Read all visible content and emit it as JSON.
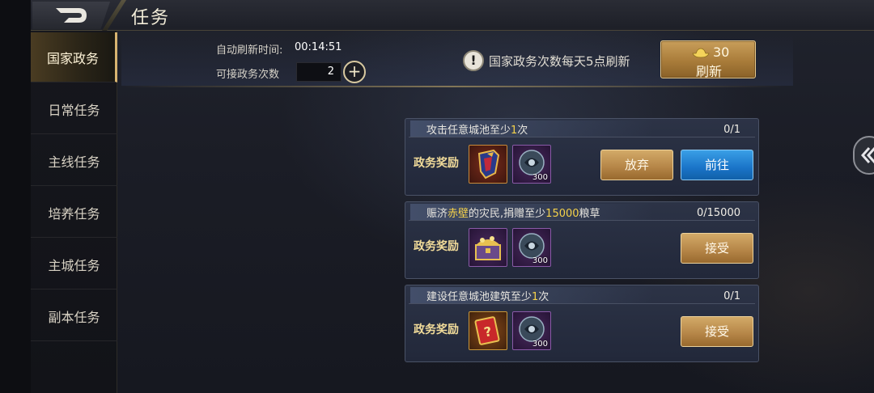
{
  "header": {
    "title": "任务"
  },
  "sidebar": {
    "items": [
      {
        "label": "国家政务",
        "active": true
      },
      {
        "label": "日常任务",
        "active": false
      },
      {
        "label": "主线任务",
        "active": false
      },
      {
        "label": "培养任务",
        "active": false
      },
      {
        "label": "主城任务",
        "active": false
      },
      {
        "label": "副本任务",
        "active": false
      }
    ]
  },
  "info": {
    "refresh_time_label": "自动刷新时间:",
    "refresh_time_value": "00:14:51",
    "count_label": "可接政务次数",
    "count_value": "2",
    "plus_glyph": "+",
    "notice_glyph": "!",
    "notice_text": "国家政务次数每天5点刷新",
    "refresh_cost": "30",
    "refresh_label": "刷新"
  },
  "reward_label": "政务奖励",
  "tasks": [
    {
      "title_parts": [
        "攻击任意城池至少",
        "1",
        "次"
      ],
      "progress": "0/1",
      "rewards": [
        {
          "icon": "armor-item-icon",
          "qty": ""
        },
        {
          "icon": "orb-resource-icon",
          "qty": "300"
        }
      ],
      "buttons": [
        "放弃",
        "前往"
      ]
    },
    {
      "title_parts": [
        "赈济",
        "赤壁",
        "的灾民,捐赠至少",
        "15000",
        "粮草"
      ],
      "progress": "0/15000",
      "rewards": [
        {
          "icon": "treasure-chest-icon",
          "qty": ""
        },
        {
          "icon": "orb-resource-icon",
          "qty": "300"
        }
      ],
      "buttons": [
        "接受"
      ]
    },
    {
      "title_parts": [
        "建设任意城池建筑至少",
        "1",
        "次"
      ],
      "progress": "0/1",
      "rewards": [
        {
          "icon": "mystery-card-icon",
          "qty": ""
        },
        {
          "icon": "orb-resource-icon",
          "qty": "300"
        }
      ],
      "buttons": [
        "接受"
      ]
    }
  ],
  "colors": {
    "highlight": "#f5d24a",
    "gold_button": "#b48446",
    "blue_button": "#1a74c8"
  }
}
